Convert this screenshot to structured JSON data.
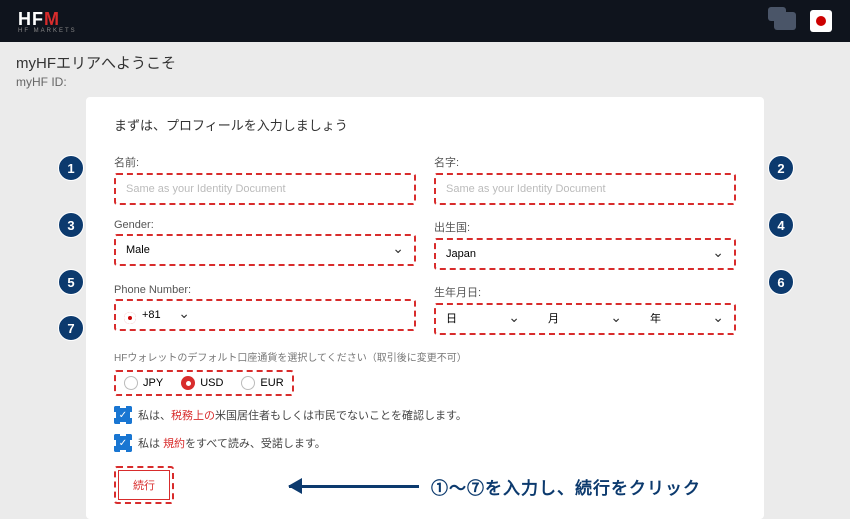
{
  "topbar": {
    "logo_main": "HF",
    "logo_accent": "M",
    "logo_sub": "HF MARKETS"
  },
  "welcome": {
    "title": "myHFエリアへようこそ",
    "id_label": "myHF ID:"
  },
  "panel": {
    "title": "まずは、プロフィールを入力しましょう"
  },
  "fields": {
    "firstname": {
      "label": "名前:",
      "placeholder": "Same as your Identity Document"
    },
    "lastname": {
      "label": "名字:",
      "placeholder": "Same as your Identity Document"
    },
    "gender": {
      "label": "Gender:",
      "value": "Male"
    },
    "country": {
      "label": "出生国:",
      "value": "Japan"
    },
    "phone": {
      "label": "Phone Number:",
      "cc": "+81"
    },
    "dob": {
      "label": "生年月日:",
      "day": "日",
      "month": "月",
      "year": "年"
    }
  },
  "currency": {
    "label": "HFウォレットのデフォルト口座通貨を選択してください（取引後に変更不可）",
    "opt1": "JPY",
    "opt2": "USD",
    "opt3": "EUR"
  },
  "checks": {
    "line1_a": "私は、",
    "line1_b": "税務上の",
    "line1_c": "米国居住者もしくは市民でないことを確認します。",
    "line2_a": "私は ",
    "line2_b": "規約",
    "line2_c": "をすべて読み、受諾します。"
  },
  "submit": "続行",
  "annotations": {
    "b1": "1",
    "b2": "2",
    "b3": "3",
    "b4": "4",
    "b5": "5",
    "b6": "6",
    "b7": "7",
    "instruction": "①〜⑦を入力し、続行をクリック"
  }
}
